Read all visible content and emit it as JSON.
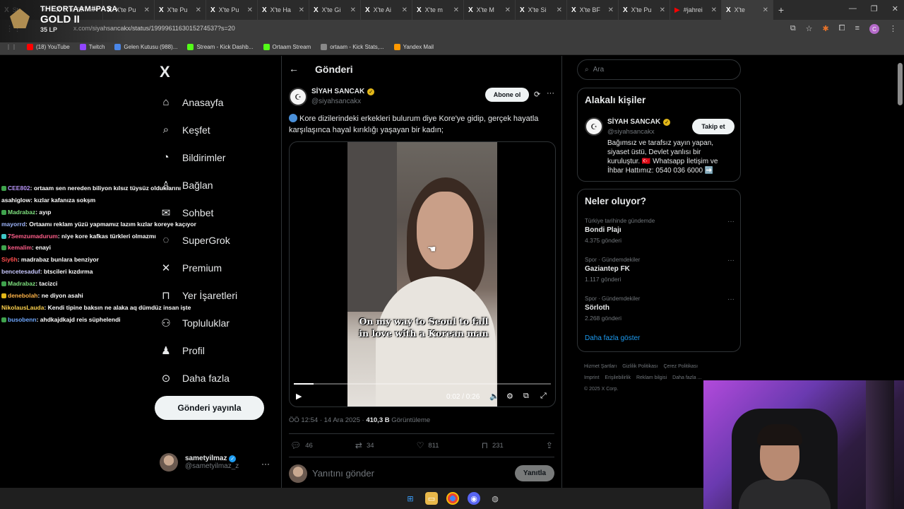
{
  "browser": {
    "tabs": [
      {
        "label": "St..."
      },
      {
        "label": "X'te BF"
      },
      {
        "label": "X'te Pu"
      },
      {
        "label": "X'te Pu"
      },
      {
        "label": "X'te Pu"
      },
      {
        "label": "X'te Ha"
      },
      {
        "label": "X'te Gi"
      },
      {
        "label": "X'te Ai"
      },
      {
        "label": "X'te m"
      },
      {
        "label": "X'te M"
      },
      {
        "label": "X'te Si"
      },
      {
        "label": "X'te BF"
      },
      {
        "label": "X'te Pu"
      },
      {
        "label": "#jahrei"
      },
      {
        "label": "X'te"
      }
    ],
    "url": "x.com/siyahsancakx/status/1999961163015274537?s=20",
    "bookmarks": [
      {
        "label": "(18) YouTube",
        "color": "#ff0000"
      },
      {
        "label": "Twitch",
        "color": "#9146ff"
      },
      {
        "label": "Gelen Kutusu (988)...",
        "color": "#4a86e8"
      },
      {
        "label": "Stream - Kick Dashb...",
        "color": "#53fc18"
      },
      {
        "label": "Ortaam Stream",
        "color": "#53fc18"
      },
      {
        "label": "ortaam - Kick Stats,...",
        "color": "#888888"
      },
      {
        "label": "Yandex Mail",
        "color": "#ff9900"
      }
    ]
  },
  "rank_overlay": {
    "name": "THEORTAAM#PASA",
    "tier": "GOLD II",
    "lp": "35 LP"
  },
  "x": {
    "logo": "X",
    "nav": [
      {
        "label": "Anasayfa",
        "icon": "home-icon",
        "glyph": "⌂"
      },
      {
        "label": "Keşfet",
        "icon": "search-icon",
        "glyph": "⌕"
      },
      {
        "label": "Bildirimler",
        "icon": "bell-icon",
        "glyph": "◔"
      },
      {
        "label": "Bağlan",
        "icon": "add-person-icon",
        "glyph": "♙"
      },
      {
        "label": "Sohbet",
        "icon": "mail-icon",
        "glyph": "✉"
      },
      {
        "label": "SuperGrok",
        "icon": "grok-icon",
        "glyph": "◌"
      },
      {
        "label": "Premium",
        "icon": "x-premium-icon",
        "glyph": "✕"
      },
      {
        "label": "Yer İşaretleri",
        "icon": "bookmark-icon",
        "glyph": "⊓"
      },
      {
        "label": "Topluluklar",
        "icon": "communities-icon",
        "glyph": "⚇"
      },
      {
        "label": "Profil",
        "icon": "profile-icon",
        "glyph": "♟"
      },
      {
        "label": "Daha fazla",
        "icon": "more-circle-icon",
        "glyph": "⊙"
      }
    ],
    "post_button": "Gönderi yayınla",
    "me": {
      "name": "sametyilmaz",
      "handle": "@sametyilmaz_z"
    }
  },
  "chat": [
    {
      "user": "CEE802",
      "color": "#b794f6",
      "badge": "#3fa34d",
      "msg": ": ortaam sen nereden biliyon kılsız tüysüz olduklarını"
    },
    {
      "user": "asahiglow",
      "color": "#ffffff",
      "badge": "",
      "msg": ": kızlar kafanıza sokşm"
    },
    {
      "user": "Madrabaz",
      "color": "#7ee07e",
      "badge": "#3fa34d",
      "msg": ": ayıp"
    },
    {
      "user": "mayorrd",
      "color": "#9fb7ff",
      "badge": "",
      "msg": ": Ortaamı reklam yüzü yapmamız lazım kızlar koreye kaçıyor"
    },
    {
      "user": "7Semzumadurum",
      "color": "#ff5e8a",
      "badge": "#3fc7c7",
      "msg": ": niye kore kafkas türkleri olmazmı"
    },
    {
      "user": "kemalim",
      "color": "#ff5e8a",
      "badge": "#3fa34d",
      "msg": ": enayi"
    },
    {
      "user": "Siy6h",
      "color": "#ff4d4d",
      "badge": "",
      "msg": ": madrabaz bunlara benziyor"
    },
    {
      "user": "bencetesaduf",
      "color": "#c9c9ff",
      "badge": "",
      "msg": ": btscileri kızdırma"
    },
    {
      "user": "Madrabaz",
      "color": "#7ee07e",
      "badge": "#3fa34d",
      "msg": ": tacizci"
    },
    {
      "user": "denebolah",
      "color": "#ffb347",
      "badge": "#e2b719",
      "msg": ": ne diyon asahi"
    },
    {
      "user": "NikolausLauda",
      "color": "#ffd24d",
      "badge": "",
      "msg": ": Kendi tipine baksın ne alaka aq dümdüz insan işte"
    },
    {
      "user": "busobenn",
      "color": "#6fa8ff",
      "badge": "#3fa34d",
      "msg": ": ahdkajdkajd reis süphelendi"
    }
  ],
  "post": {
    "header_title": "Gönderi",
    "author_name": "SİYAH SANCAK",
    "author_handle": "@siyahsancakx",
    "subscribe": "Abone ol",
    "text": "Kore dizilerindeki erkekleri bulurum diye Kore'ye gidip, gerçek hayatla karşılaşınca hayal kırıklığı yaşayan bir kadın;",
    "video_caption": "On my way to Seoul to fall in love with a Korean man",
    "video_time": "0:02 / 0:26",
    "video_progress": 0.077,
    "timestamp": "ÖÖ 12:54 · 14 Ara 2025 · ",
    "views": "410,3 B",
    "views_label": " Görüntüleme",
    "replies": "46",
    "reposts": "34",
    "likes": "811",
    "bookmarks": "231",
    "reply_placeholder": "Yanıtını gönder",
    "reply_button": "Yanıtla"
  },
  "sidebar": {
    "search_placeholder": "Ara",
    "related_title": "Alakalı kişiler",
    "related": {
      "name": "SİYAH SANCAK",
      "handle": "@siyahsancakx",
      "follow": "Takip et",
      "bio": "Bağımsız ve tarafsız yayın yapan, siyaset üstü, Devlet yanlısı bir kuruluştur. 🇹🇷 Whatsapp İletişim ve İhbar Hattımız: 0540 036 6000 ➡️"
    },
    "trends_title": "Neler oluyor?",
    "trends": [
      {
        "category": "Türkiye tarihinde gündemde",
        "name": "Bondi Plajı",
        "count": "4.375 gönderi"
      },
      {
        "category": "Spor · Gündemdekiler",
        "name": "Gaziantep FK",
        "count": "1.117 gönderi"
      },
      {
        "category": "Spor · Gündemdekiler",
        "name": "Sörloth",
        "count": "2.268 gönderi"
      }
    ],
    "show_more": "Daha fazla göster",
    "footer": [
      "Hizmet Şartları",
      "Gizlilik Politikası",
      "Çerez Politikası",
      "Imprint",
      "Erişilebilirlik",
      "Reklam bilgisi",
      "Daha fazla ...",
      "© 2025 X Corp."
    ]
  }
}
